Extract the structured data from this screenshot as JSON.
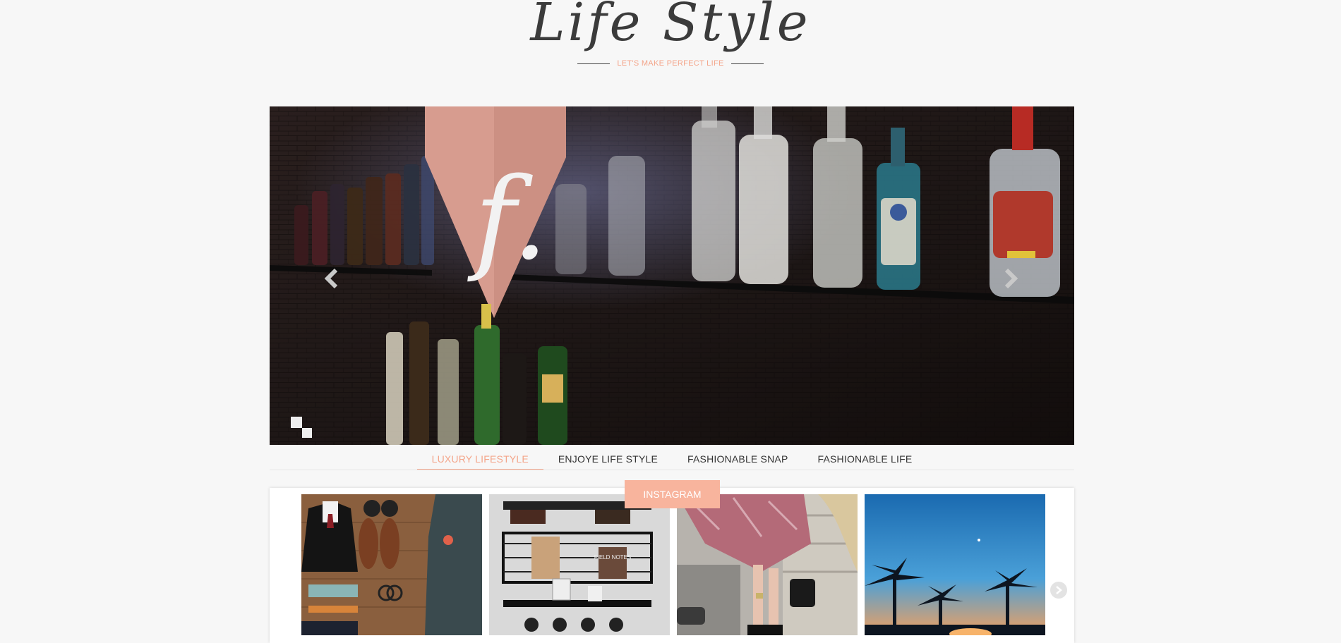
{
  "header": {
    "title": "Life Style",
    "tagline": "LET'S MAKE PERFECT LIFE"
  },
  "slider": {
    "logo_letter": "f.",
    "prev_icon": "chevron-left-icon",
    "next_icon": "chevron-right-icon"
  },
  "tabs": [
    {
      "label": "LUXURY LIFESTYLE",
      "active": true
    },
    {
      "label": "ENJOYE LIFE STYLE",
      "active": false
    },
    {
      "label": "FASHIONABLE SNAP",
      "active": false
    },
    {
      "label": "FASHIONABLE LIFE",
      "active": false
    }
  ],
  "instagram": {
    "button_label": "INSTAGRAM",
    "next_icon": "chevron-right-icon",
    "notebook_text": "FIELD NOTES"
  },
  "colors": {
    "accent": "#f4a58a",
    "button": "#f8b49d",
    "background": "#f7f7f7"
  }
}
